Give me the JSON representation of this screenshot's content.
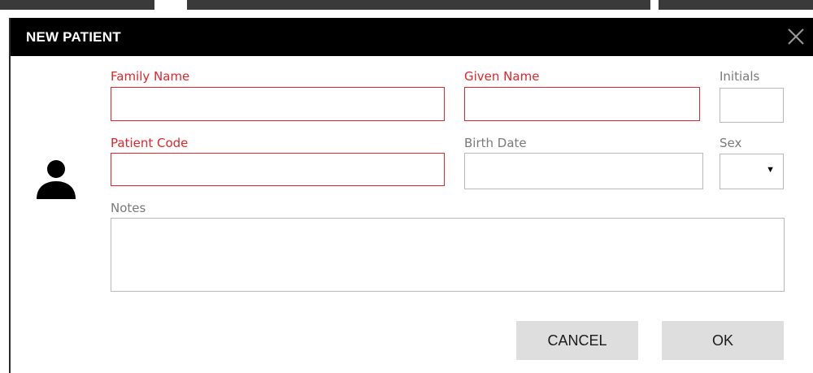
{
  "dialog": {
    "title": "NEW PATIENT",
    "close_icon": "close-icon"
  },
  "avatar_icon": "user-icon",
  "form": {
    "family_name": {
      "label": "Family Name",
      "value": "",
      "required": true
    },
    "given_name": {
      "label": "Given Name",
      "value": "",
      "required": true
    },
    "initials": {
      "label": "Initials",
      "value": ""
    },
    "patient_code": {
      "label": "Patient Code",
      "value": "",
      "required": true
    },
    "birth_date": {
      "label": "Birth Date",
      "value": ""
    },
    "sex": {
      "label": "Sex",
      "value": ""
    },
    "notes": {
      "label": "Notes",
      "value": ""
    }
  },
  "buttons": {
    "cancel": "CANCEL",
    "ok": "OK"
  },
  "colors": {
    "required": "#e0252b",
    "titlebar": "#000000",
    "button_bg": "#dedede"
  }
}
